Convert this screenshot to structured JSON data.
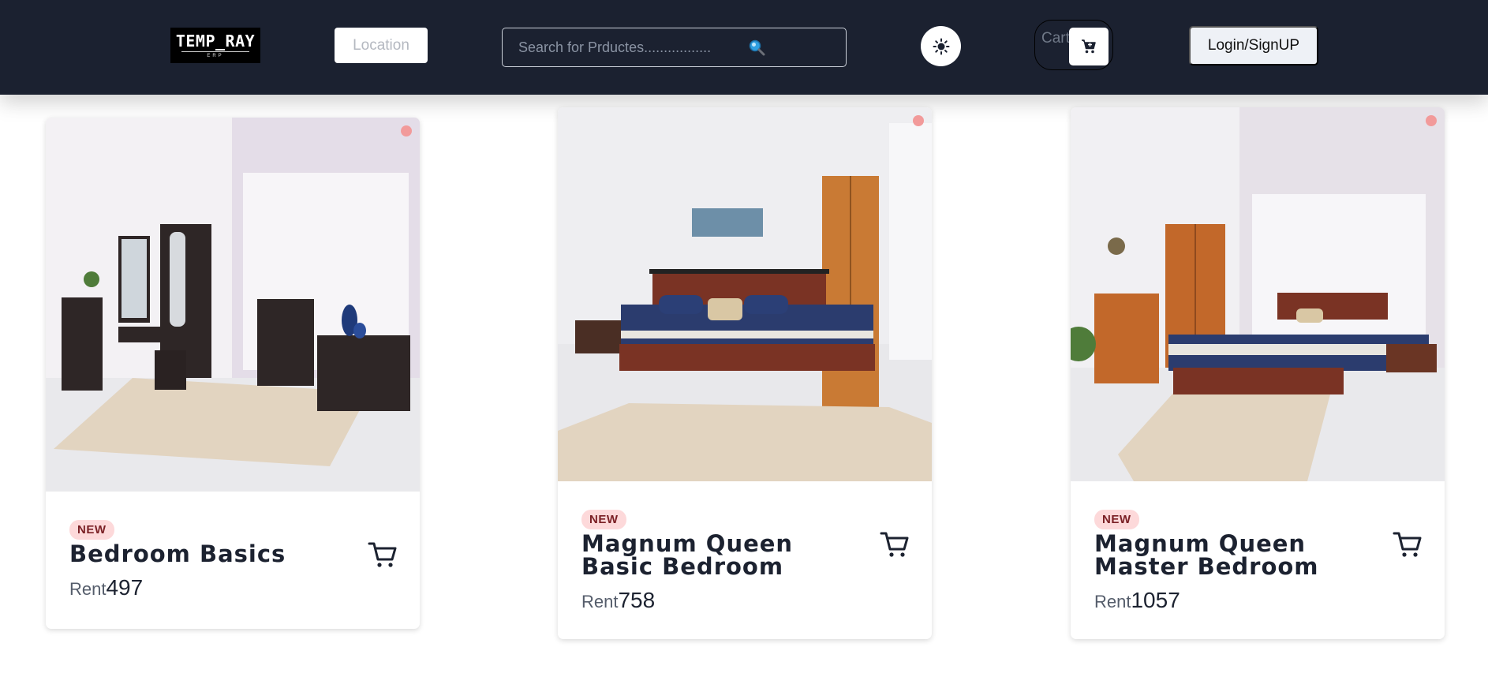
{
  "navbar": {
    "logo_text": "TEMP_RAY",
    "logo_sub": "ERP",
    "location_label": "Location",
    "search_placeholder": "Search for Prductes.................",
    "cart_label": "Cart",
    "login_label": "Login/SignUP"
  },
  "products": [
    {
      "badge": "NEW",
      "title": "Bedroom Basics",
      "price_label": "Rent",
      "price": "497"
    },
    {
      "badge": "NEW",
      "title": "Magnum Queen Basic Bedroom",
      "price_label": "Rent",
      "price": "758"
    },
    {
      "badge": "NEW",
      "title": "Magnum Queen Master Bedroom",
      "price_label": "Rent",
      "price": "1057"
    }
  ],
  "colors": {
    "navbar_bg": "#1b2130",
    "badge_bg": "#fdd9da",
    "badge_text": "#7a1f24",
    "status_dot": "#f29a9a"
  }
}
